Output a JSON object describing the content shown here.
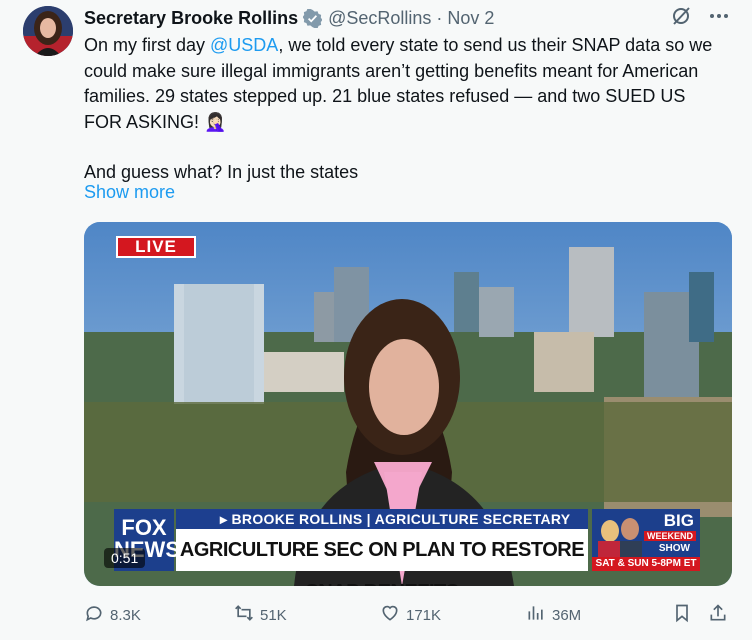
{
  "post": {
    "author_name": "Secretary Brooke Rollins",
    "handle": "@SecRollins",
    "separator": "·",
    "date": "Nov 2",
    "mention": "@USDA",
    "text_p1_a": "On my first day ",
    "text_p1_b": ", we told every state to send us their SNAP data so we could make sure illegal immigrants aren’t getting benefits meant for American families. 29 states stepped up. 21 blue states refused — and two SUED US FOR ASKING! 🤦🏻‍♀️",
    "text_p2": "And guess what? In just the states",
    "show_more": "Show more"
  },
  "video": {
    "live_label": "LIVE",
    "network_logo": "FOX NEWS",
    "chyron_top": "▸ BROOKE ROLLINS | AGRICULTURE SECRETARY",
    "chyron_main": "AGRICULTURE SEC ON PLAN TO RESTORE SNAP BENEFITS",
    "duration": "0:51",
    "promo_title": "BIG",
    "promo_sub": "WEEKEND",
    "promo_show": "SHOW",
    "promo_time": "SAT & SUN 5-8PM ET"
  },
  "actions": {
    "replies": "8.3K",
    "reposts": "51K",
    "likes": "171K",
    "views": "36M"
  },
  "colors": {
    "link": "#1d9bf0",
    "secondary_text": "#536471",
    "verified_badge": "#829aab"
  }
}
